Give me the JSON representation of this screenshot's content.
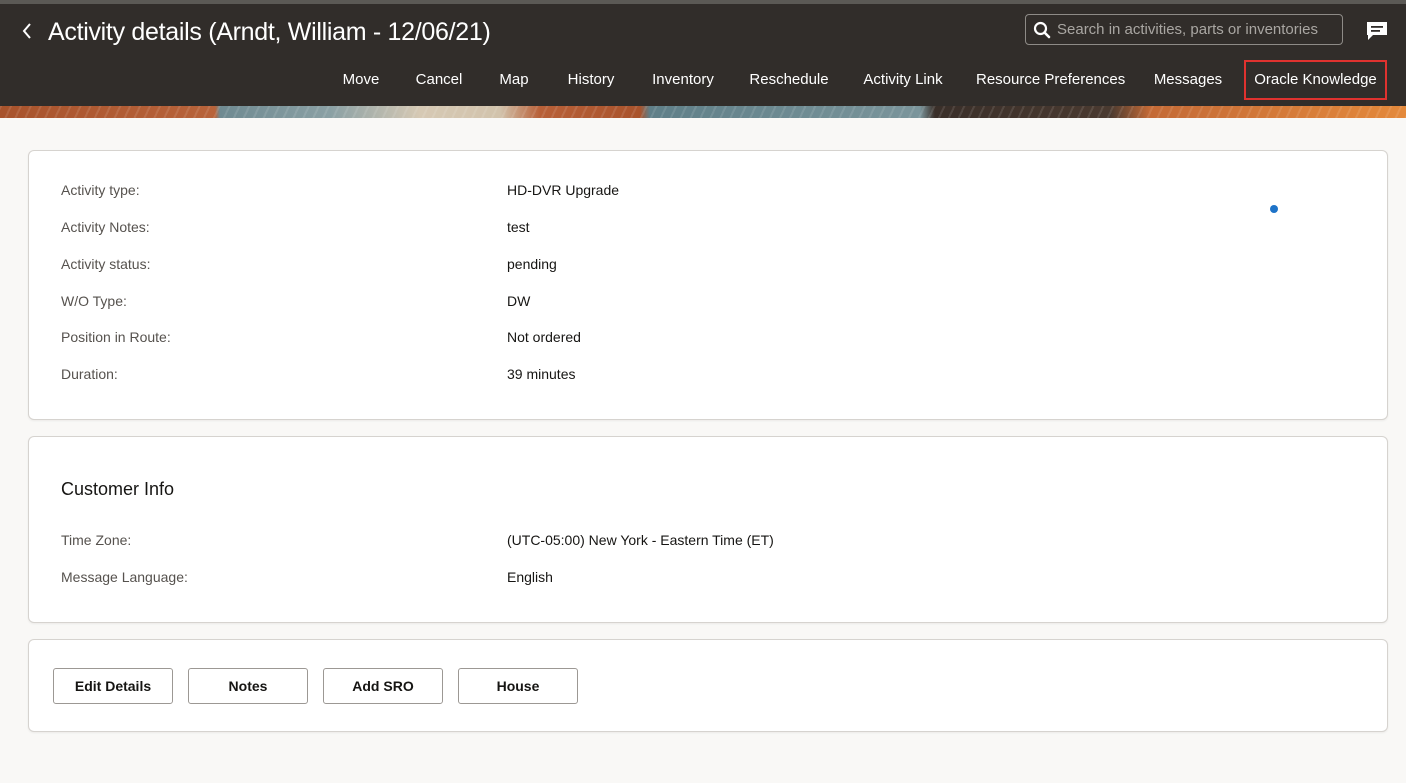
{
  "header": {
    "title": "Activity details (Arndt, William - 12/06/21)",
    "search_placeholder": "Search in activities, parts or inventories",
    "back_icon": "chevron-left-icon",
    "chat_icon": "chat-bubble-icon"
  },
  "nav": {
    "items": [
      {
        "label": "Move"
      },
      {
        "label": "Cancel"
      },
      {
        "label": "Map"
      },
      {
        "label": "History"
      },
      {
        "label": "Inventory"
      },
      {
        "label": "Reschedule"
      },
      {
        "label": "Activity Link"
      },
      {
        "label": "Resource Preferences"
      },
      {
        "label": "Messages"
      },
      {
        "label": "Oracle Knowledge",
        "active": true
      }
    ],
    "active_border_color": "#e0322f"
  },
  "activity": {
    "fields": [
      {
        "label": "Activity type:",
        "value": "HD-DVR Upgrade"
      },
      {
        "label": "Activity Notes:",
        "value": "test"
      },
      {
        "label": "Activity status:",
        "value": "pending"
      },
      {
        "label": "W/O Type:",
        "value": "DW"
      },
      {
        "label": "Position in Route:",
        "value": "Not ordered"
      },
      {
        "label": "Duration:",
        "value": "39 minutes"
      }
    ]
  },
  "customer": {
    "title": "Customer Info",
    "fields": [
      {
        "label": "Time Zone:",
        "value": "(UTC-05:00) New York - Eastern Time (ET)"
      },
      {
        "label": "Message Language:",
        "value": "English"
      }
    ]
  },
  "actions": {
    "buttons": [
      {
        "label": "Edit Details"
      },
      {
        "label": "Notes"
      },
      {
        "label": "Add SRO"
      },
      {
        "label": "House"
      }
    ]
  },
  "colors": {
    "header_bg": "#312d2a",
    "page_bg": "#f9f8f6",
    "indicator_dot": "#1e73c8"
  }
}
